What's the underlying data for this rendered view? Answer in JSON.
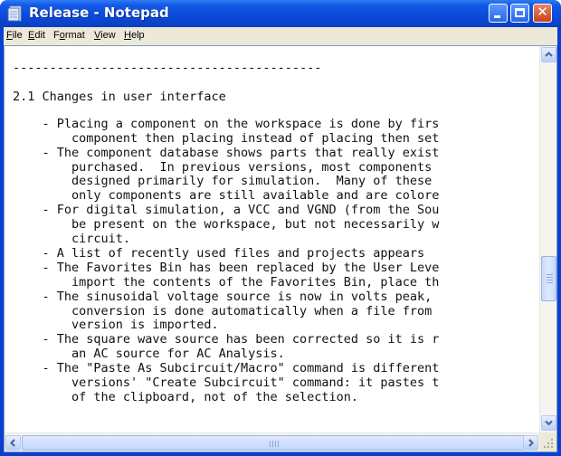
{
  "window": {
    "title": "Release - Notepad",
    "app_icon": "notepad-icon",
    "controls": {
      "minimize": "minimize-icon",
      "maximize": "maximize-icon",
      "close_glyph": "✕"
    }
  },
  "menu": {
    "items": [
      {
        "label": "File",
        "underline": "F"
      },
      {
        "label": "Edit",
        "underline": "E"
      },
      {
        "label": "Format",
        "underline": "o"
      },
      {
        "label": "View",
        "underline": "V"
      },
      {
        "label": "Help",
        "underline": "H"
      }
    ]
  },
  "document": {
    "lines": [
      "------------------------------------------",
      "",
      "2.1 Changes in user interface",
      "",
      "    - Placing a component on the workspace is done by firs",
      "        component then placing instead of placing then set",
      "    - The component database shows parts that really exist",
      "        purchased.  In previous versions, most components",
      "        designed primarily for simulation.  Many of these",
      "        only components are still available and are colore",
      "    - For digital simulation, a VCC and VGND (from the Sou",
      "        be present on the workspace, but not necessarily w",
      "        circuit.",
      "    - A list of recently used files and projects appears",
      "    - The Favorites Bin has been replaced by the User Leve",
      "        import the contents of the Favorites Bin, place th",
      "    - The sinusoidal voltage source is now in volts peak,",
      "        conversion is done automatically when a file from",
      "        version is imported.",
      "    - The square wave source has been corrected so it is r",
      "        an AC source for AC Analysis.",
      "    - The \"Paste As Subcircuit/Macro\" command is different",
      "        versions' \"Create Subcircuit\" command: it pastes t",
      "        of the clipboard, not of the selection."
    ]
  },
  "scrollbars": {
    "vertical": {
      "up": "scroll-up-arrow-icon",
      "down": "scroll-down-arrow-icon"
    },
    "horizontal": {
      "left": "scroll-left-arrow-icon",
      "right": "scroll-right-arrow-icon"
    }
  },
  "colors": {
    "titlebar": "#0a49d8",
    "menubar": "#ece9d8",
    "close": "#c8431e"
  }
}
